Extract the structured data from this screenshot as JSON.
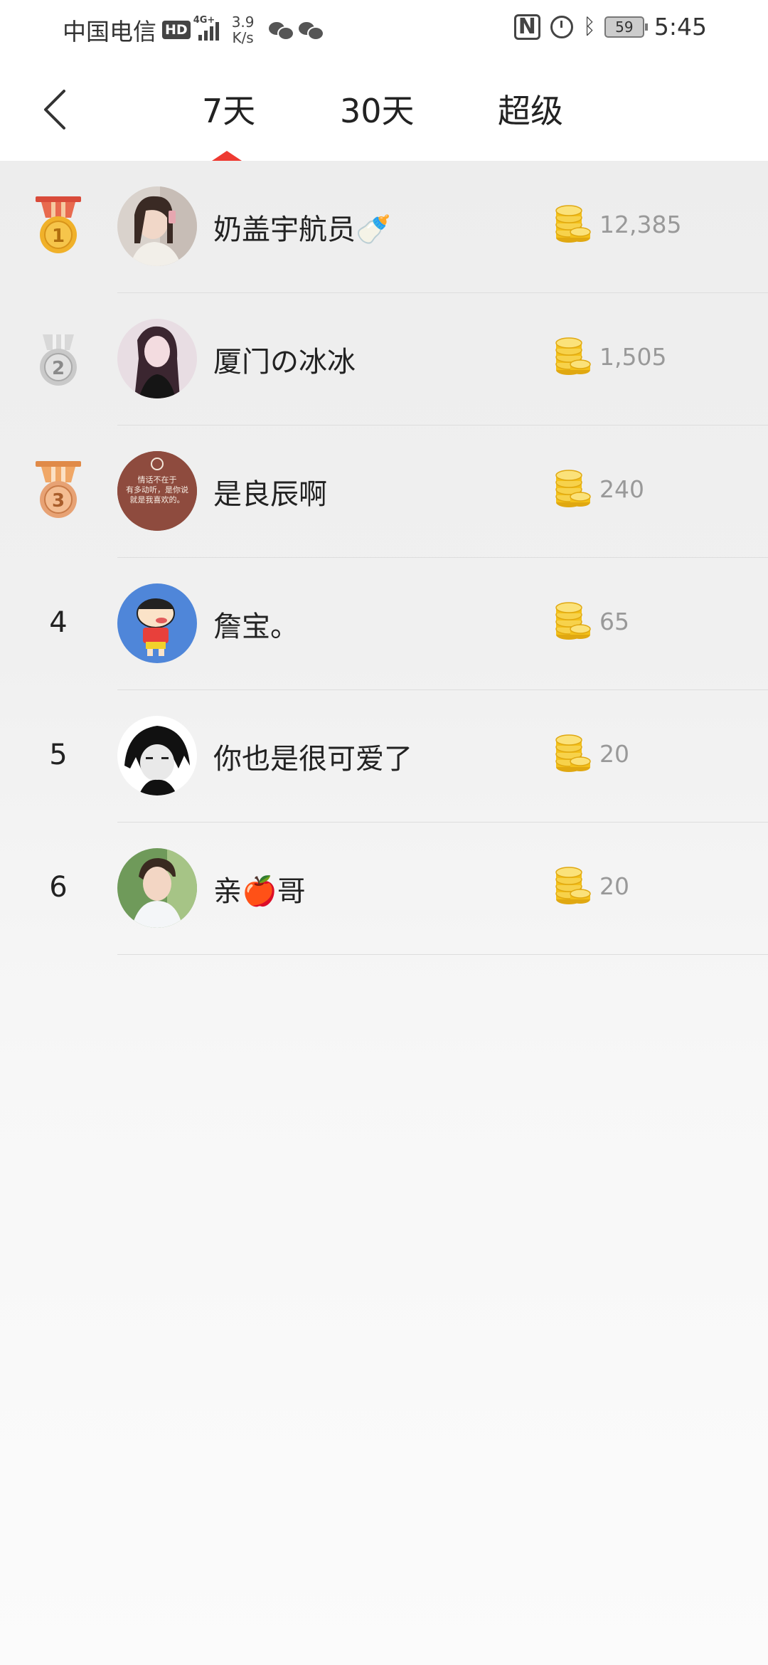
{
  "status_bar": {
    "carrier": "中国电信",
    "hd": "HD",
    "network_tag": "4G+",
    "net_speed_value": "3.9",
    "net_speed_unit": "K/s",
    "battery": "59",
    "time": "5:45",
    "icons": [
      "hd-icon",
      "signal-icon",
      "wechat-icon",
      "wechat-icon",
      "nfc-icon",
      "alarm-icon",
      "bluetooth-icon",
      "battery-icon"
    ]
  },
  "header": {
    "back_icon": "chevron-left-icon",
    "tabs": [
      {
        "label": "7天",
        "selected": true
      },
      {
        "label": "30天",
        "selected": false
      },
      {
        "label": "超级",
        "selected": false
      }
    ],
    "accent_color": "#ee3a32"
  },
  "ranking": [
    {
      "rank": "1",
      "medal": "gold",
      "name": "奶盖宇航员🍼",
      "score": "12,385"
    },
    {
      "rank": "2",
      "medal": "silver",
      "name": "厦门の冰冰",
      "score": "1,505"
    },
    {
      "rank": "3",
      "medal": "bronze",
      "name": "是良辰啊",
      "score": "240",
      "avatar_text": [
        "情话不在于",
        "有多动听，是你说",
        "就是我喜欢的。"
      ]
    },
    {
      "rank": "4",
      "medal": null,
      "name": "詹宝。",
      "score": "65"
    },
    {
      "rank": "5",
      "medal": null,
      "name": "你也是很可爱了",
      "score": "20"
    },
    {
      "rank": "6",
      "medal": null,
      "name": "亲🍎哥",
      "score": "20"
    }
  ],
  "colors": {
    "gold": "#f0b12a",
    "silver": "#c9c9c9",
    "bronze": "#e7a274",
    "coin": "#f3c019",
    "score_text": "#999999"
  }
}
